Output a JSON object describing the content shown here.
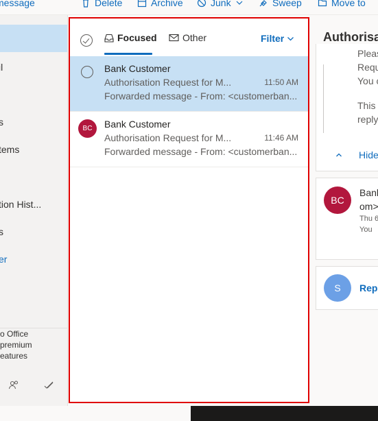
{
  "toolbar": {
    "items": [
      {
        "label": "message",
        "icon": "new-message-icon"
      },
      {
        "label": "Delete",
        "icon": "trash-icon"
      },
      {
        "label": "Archive",
        "icon": "archive-icon"
      },
      {
        "label": "Junk",
        "icon": "block-icon"
      },
      {
        "label": "Sweep",
        "icon": "broom-icon"
      },
      {
        "label": "Move to",
        "icon": "folder-move-icon"
      }
    ]
  },
  "leftnav": {
    "items": [
      {
        "label": "il"
      },
      {
        "label": "s"
      },
      {
        "label": "tems"
      },
      {
        "label": "tion Hist..."
      },
      {
        "label": "s"
      },
      {
        "label": "er"
      }
    ],
    "promo": [
      "o Office",
      "premium",
      "eatures"
    ],
    "footer_icons": [
      "people-icon",
      "tasks-icon"
    ]
  },
  "message_list": {
    "tabs": {
      "focused": "Focused",
      "other": "Other"
    },
    "filter_label": "Filter",
    "messages": [
      {
        "sender": "Bank Customer",
        "subject": "Authorisation Request for M...",
        "time": "11:50 AM",
        "preview": "Forwarded message - From: <customerban...",
        "selected": true,
        "avatar": ""
      },
      {
        "sender": "Bank Customer",
        "subject": "Authorisation Request for M...",
        "time": "11:46 AM",
        "preview": "Forwarded message - From: <customerban...",
        "selected": false,
        "avatar": "BC"
      }
    ]
  },
  "reading_pane": {
    "title": "Authorisat",
    "body_lines": [
      "Pleas",
      "Requ",
      "You c",
      "This",
      "reply"
    ],
    "hide_label": "Hide",
    "sender_avatar": "BC",
    "sender_lines": [
      "Bank",
      "om>"
    ],
    "meta_lines": [
      "Thu 6",
      "You"
    ],
    "reply_avatar": "S",
    "reply_label": "Repl"
  },
  "colors": {
    "accent": "#0f6cbd",
    "selected_row": "#c7e0f4",
    "avatar_bc": "#b2173d",
    "avatar_s": "#6ca0e6",
    "highlight_border": "#e00000"
  }
}
